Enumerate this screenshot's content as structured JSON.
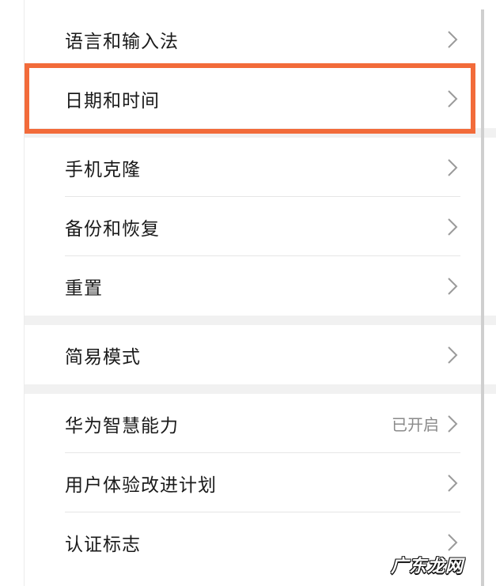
{
  "settings": {
    "group1": [
      {
        "label": "语言和输入法"
      },
      {
        "label": "日期和时间",
        "highlighted": true
      }
    ],
    "group2": [
      {
        "label": "手机克隆"
      },
      {
        "label": "备份和恢复"
      },
      {
        "label": "重置"
      }
    ],
    "group3": [
      {
        "label": "简易模式"
      }
    ],
    "group4": [
      {
        "label": "华为智慧能力",
        "value": "已开启"
      },
      {
        "label": "用户体验改进计划"
      },
      {
        "label": "认证标志"
      }
    ]
  },
  "colors": {
    "highlight": "#f26b3a",
    "text": "#1a1a1a",
    "value_text": "#8a8a8a",
    "chevron": "#9a9a9a",
    "section_gap": "#f1f1f1"
  },
  "icons": {
    "row_arrow": "chevron-right-icon"
  },
  "watermark": {
    "text": "广东龙网"
  }
}
